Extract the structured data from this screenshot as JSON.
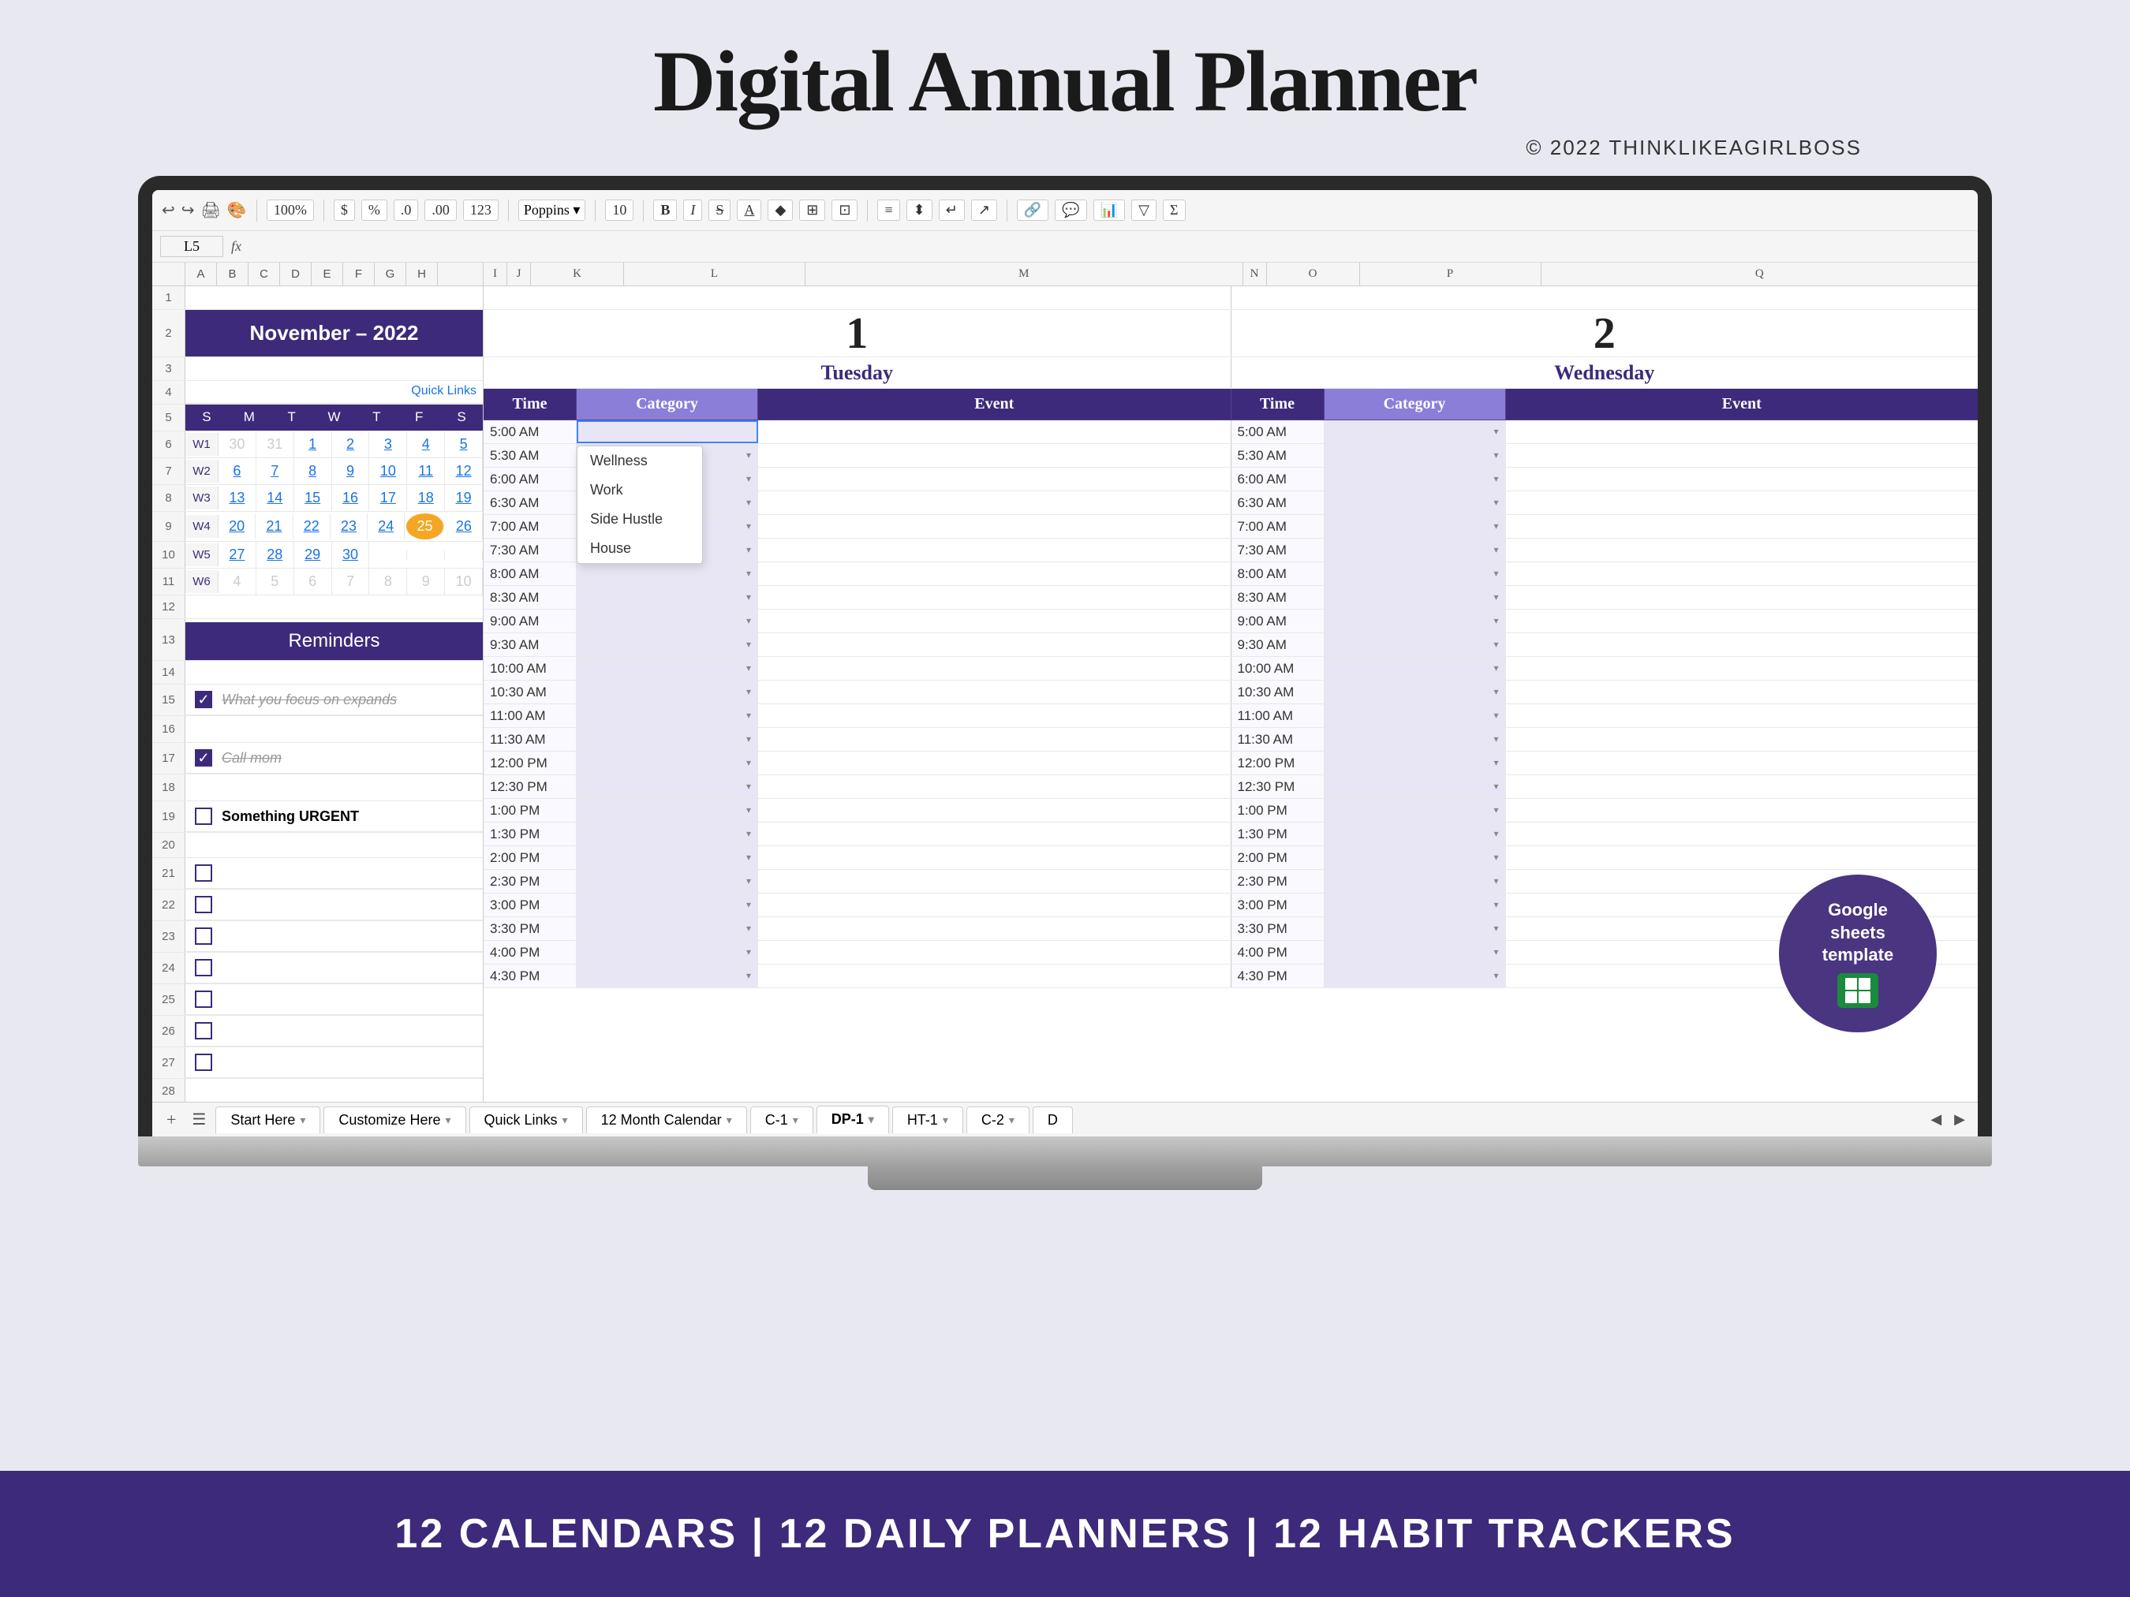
{
  "page": {
    "title": "Digital Annual Planner",
    "copyright": "© 2022 THINKLIKEAGIRLBOSS"
  },
  "toolbar": {
    "zoom": "100%",
    "currency": "$",
    "percent": "%",
    "decimal1": ".0",
    "decimal2": ".00",
    "format": "123",
    "font": "Poppins",
    "font_size": "10"
  },
  "formula_bar": {
    "cell_ref": "L5",
    "fx": "fx"
  },
  "calendar": {
    "month_label": "November – 2022",
    "day_headers": [
      "S",
      "M",
      "T",
      "W",
      "T",
      "F",
      "S"
    ],
    "weeks": [
      {
        "week": "W1",
        "days": [
          "30",
          "31",
          "1",
          "2",
          "3",
          "4",
          "5"
        ]
      },
      {
        "week": "W2",
        "days": [
          "6",
          "7",
          "8",
          "9",
          "10",
          "11",
          "12"
        ]
      },
      {
        "week": "W3",
        "days": [
          "13",
          "14",
          "15",
          "16",
          "17",
          "18",
          "19"
        ]
      },
      {
        "week": "W4",
        "days": [
          "20",
          "21",
          "22",
          "23",
          "24",
          "25",
          "26"
        ]
      },
      {
        "week": "W5",
        "days": [
          "27",
          "28",
          "29",
          "30",
          "",
          "",
          ""
        ]
      },
      {
        "week": "W6",
        "days": [
          "4",
          "5",
          "6",
          "7",
          "8",
          "9",
          "10"
        ]
      }
    ],
    "quick_links": "Quick Links",
    "reminders_label": "Reminders",
    "reminders": [
      {
        "checked": true,
        "text": "What you focus on expands",
        "done": true
      },
      {
        "checked": true,
        "text": "Call mom",
        "done": true
      },
      {
        "checked": false,
        "text": "Something URGENT",
        "done": false
      },
      {
        "checked": false,
        "text": "",
        "done": false
      },
      {
        "checked": false,
        "text": "",
        "done": false
      },
      {
        "checked": false,
        "text": "",
        "done": false
      },
      {
        "checked": false,
        "text": "",
        "done": false
      },
      {
        "checked": false,
        "text": "",
        "done": false
      }
    ]
  },
  "planner": {
    "day1": {
      "number": "1",
      "name": "Tuesday"
    },
    "day2": {
      "number": "2",
      "name": "Wednesday"
    },
    "col_headers": [
      "Time",
      "Category",
      "Event",
      "Time",
      "Category",
      "Event"
    ],
    "times": [
      "5:00 AM",
      "5:30 AM",
      "6:00 AM",
      "6:30 AM",
      "7:00 AM",
      "7:30 AM",
      "8:00 AM",
      "8:30 AM",
      "9:00 AM",
      "9:30 AM",
      "10:00 AM",
      "10:30 AM",
      "11:00 AM",
      "11:30 AM",
      "12:00 PM",
      "12:30 PM",
      "1:00 PM",
      "1:30 PM",
      "2:00 PM",
      "2:30 PM",
      "3:00 PM",
      "3:30 PM",
      "4:00 PM",
      "4:30 PM"
    ],
    "dropdown_options": [
      "Wellness",
      "Work",
      "Side Hustle",
      "House"
    ]
  },
  "sheet_tabs": [
    {
      "label": "Start Here",
      "active": false
    },
    {
      "label": "Customize Here",
      "active": false
    },
    {
      "label": "Quick Links",
      "active": false
    },
    {
      "label": "12 Month Calendar",
      "active": false
    },
    {
      "label": "C-1",
      "active": false
    },
    {
      "label": "DP-1",
      "active": true
    },
    {
      "label": "HT-1",
      "active": false
    },
    {
      "label": "C-2",
      "active": false
    },
    {
      "label": "D",
      "active": false
    }
  ],
  "google_badge": {
    "text": "Google\nsheets\ntemplate"
  },
  "bottom_banner": {
    "text": "12 CALENDARS  |  12 DAILY PLANNERS  |  12 HABIT TRACKERS"
  },
  "row_numbers": [
    "1",
    "2",
    "3",
    "4",
    "5",
    "6",
    "7",
    "8",
    "9",
    "10",
    "11",
    "12",
    "13",
    "14",
    "15",
    "16",
    "17",
    "18",
    "19",
    "20",
    "21",
    "22",
    "23",
    "24",
    "25",
    "26",
    "27",
    "28"
  ]
}
